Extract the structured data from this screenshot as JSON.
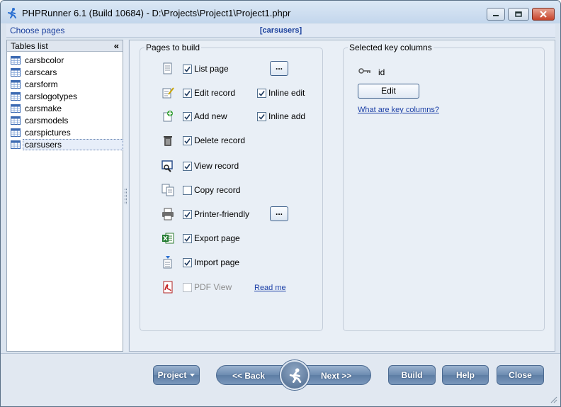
{
  "window": {
    "title": "PHPRunner 6.1 (Build 10684) - D:\\Projects\\Project1\\Project1.phpr"
  },
  "header": {
    "choose_pages": "Choose pages",
    "table_title": "[carsusers]"
  },
  "tables_panel": {
    "title": "Tables list",
    "collapse_glyph": "«",
    "items": [
      {
        "label": "carsbcolor",
        "selected": false
      },
      {
        "label": "carscars",
        "selected": false
      },
      {
        "label": "carsform",
        "selected": false
      },
      {
        "label": "carslogotypes",
        "selected": false
      },
      {
        "label": "carsmake",
        "selected": false
      },
      {
        "label": "carsmodels",
        "selected": false
      },
      {
        "label": "carspictures",
        "selected": false
      },
      {
        "label": "carsusers",
        "selected": true
      }
    ]
  },
  "pages_group": {
    "title": "Pages to build",
    "list_page": {
      "label": "List page",
      "checked": true,
      "icon": "list-page-icon",
      "more": "..."
    },
    "edit_record": {
      "label": "Edit record",
      "checked": true,
      "icon": "edit-record-icon"
    },
    "inline_edit": {
      "label": "Inline edit",
      "checked": true
    },
    "add_new": {
      "label": "Add new",
      "checked": true,
      "icon": "add-new-icon"
    },
    "inline_add": {
      "label": "Inline add",
      "checked": true
    },
    "delete_record": {
      "label": "Delete record",
      "checked": true,
      "icon": "trash-icon"
    },
    "view_record": {
      "label": "View record",
      "checked": true,
      "icon": "view-record-icon"
    },
    "copy_record": {
      "label": "Copy record",
      "checked": false,
      "icon": "copy-record-icon"
    },
    "printer_friendly": {
      "label": "Printer-friendly",
      "checked": true,
      "icon": "printer-icon",
      "more": "..."
    },
    "export_page": {
      "label": "Export page",
      "checked": true,
      "icon": "excel-export-icon"
    },
    "import_page": {
      "label": "Import page",
      "checked": true,
      "icon": "import-page-icon"
    },
    "pdf_view": {
      "label": "PDF View",
      "checked": false,
      "disabled": true,
      "icon": "pdf-icon",
      "link": "Read me"
    }
  },
  "key_group": {
    "title": "Selected key columns",
    "key_column": "id",
    "edit_label": "Edit",
    "help_link": "What are key columns?"
  },
  "footer": {
    "project": "Project",
    "back": "<< Back",
    "next": "Next >>",
    "build": "Build",
    "help": "Help",
    "close": "Close"
  },
  "colors": {
    "accent_blue": "#1a3f9c",
    "button_blue": "#6c8bb1",
    "close_red": "#c7432a"
  }
}
